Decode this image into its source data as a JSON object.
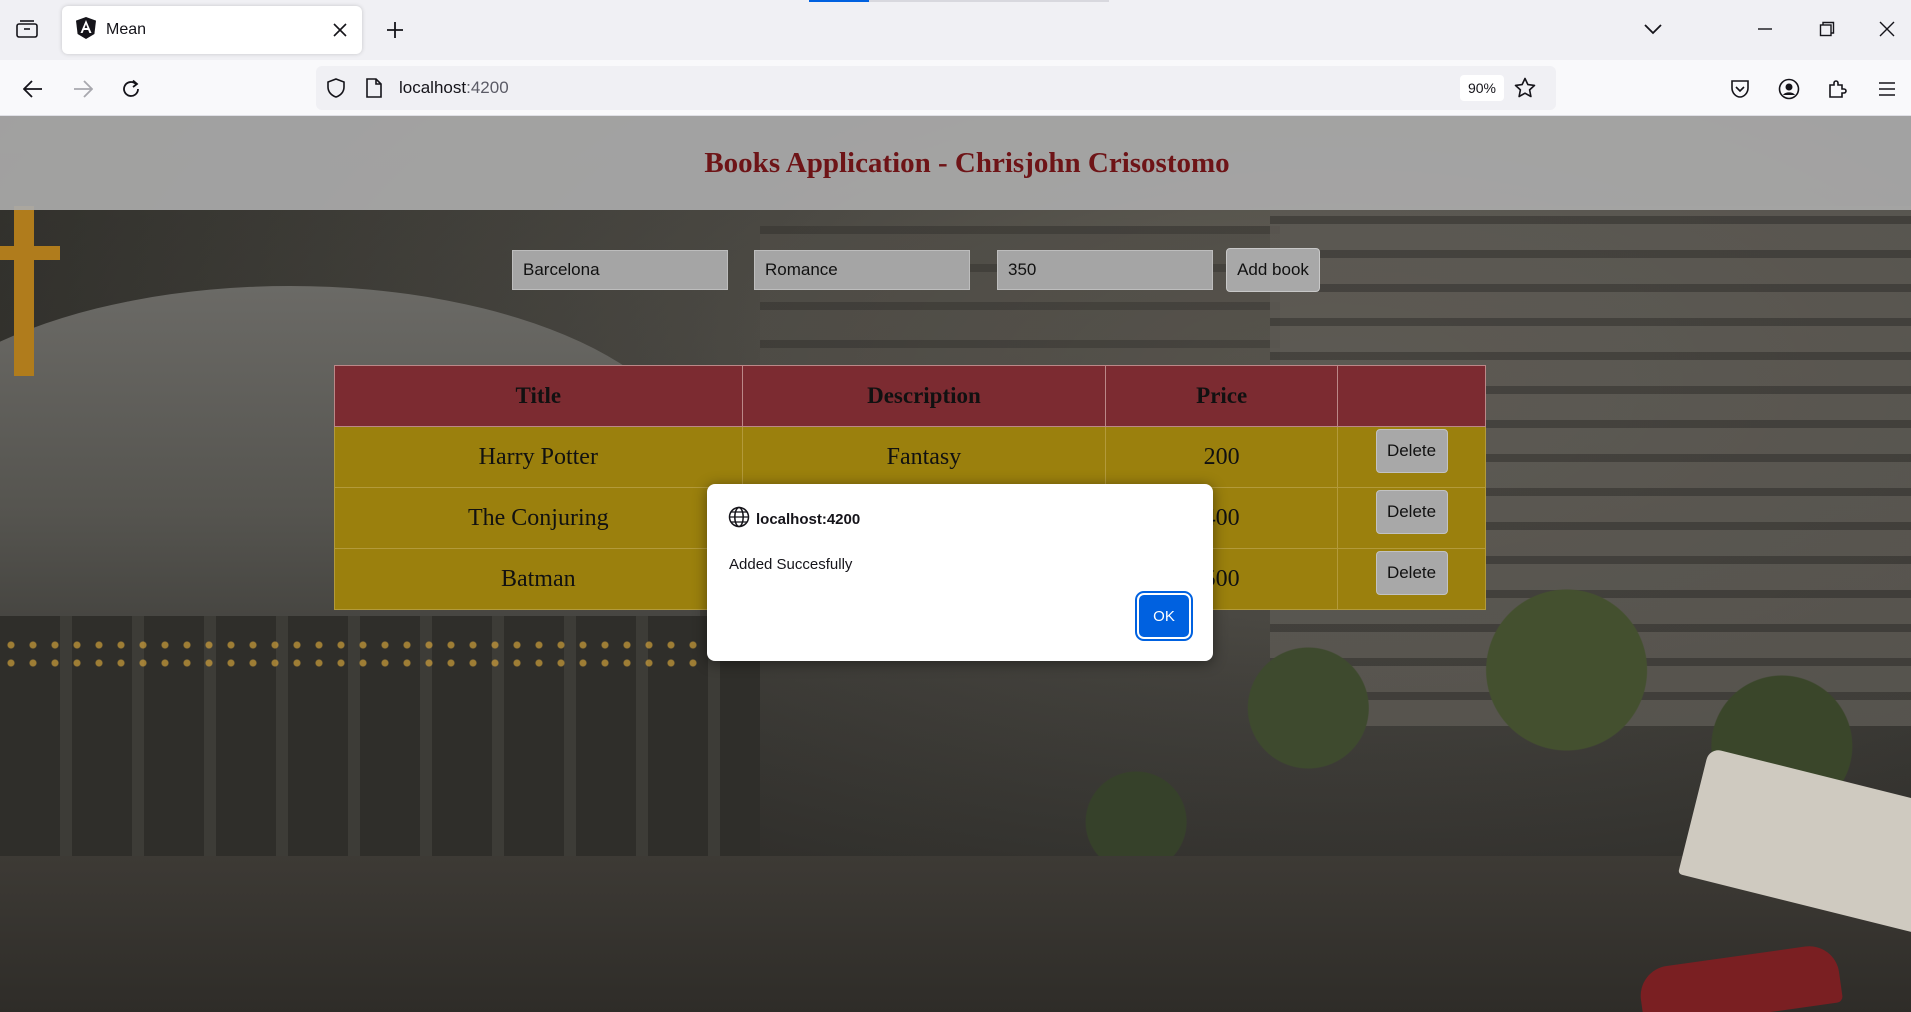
{
  "browser": {
    "tab_title": "Mean",
    "url_host": "localhost",
    "url_port": ":4200",
    "zoom": "90%"
  },
  "icons": {
    "tab_list": "tab-list-icon",
    "tab_favicon": "angular-icon",
    "tab_close": "close-icon",
    "new_tab": "plus-icon",
    "list_all_tabs": "chevron-down-icon",
    "minimize": "minimize-icon",
    "restore": "restore-icon",
    "window_close": "close-icon",
    "back": "back-arrow-icon",
    "forward": "forward-arrow-icon",
    "reload": "reload-icon",
    "tracking_protection": "shield-icon",
    "page_info": "page-icon",
    "bookmark": "star-icon",
    "pocket": "pocket-icon",
    "account": "account-icon",
    "extensions": "puzzle-icon",
    "menu": "hamburger-icon",
    "dialog_origin": "globe-icon"
  },
  "app": {
    "title": "Books Application - Chrisjohn Crisostomo",
    "form": {
      "title_value": "Barcelona",
      "description_value": "Romance",
      "price_value": "350",
      "add_label": "Add book"
    },
    "table": {
      "headers": [
        "Title",
        "Description",
        "Price",
        ""
      ],
      "rows": [
        {
          "title": "Harry Potter",
          "description": "Fantasy",
          "price": "200",
          "action": "Delete"
        },
        {
          "title": "The Conjuring",
          "description": "",
          "price": "400",
          "action": "Delete"
        },
        {
          "title": "Batman",
          "description": "",
          "price": "500",
          "action": "Delete"
        }
      ]
    }
  },
  "dialog": {
    "origin": "localhost:4200",
    "message": "Added Succesfully",
    "ok_label": "OK"
  },
  "colors": {
    "accent": "#0061e0",
    "header_title": "#6e1417",
    "table_head": "#7c2b31",
    "table_row": "#9b800d"
  }
}
